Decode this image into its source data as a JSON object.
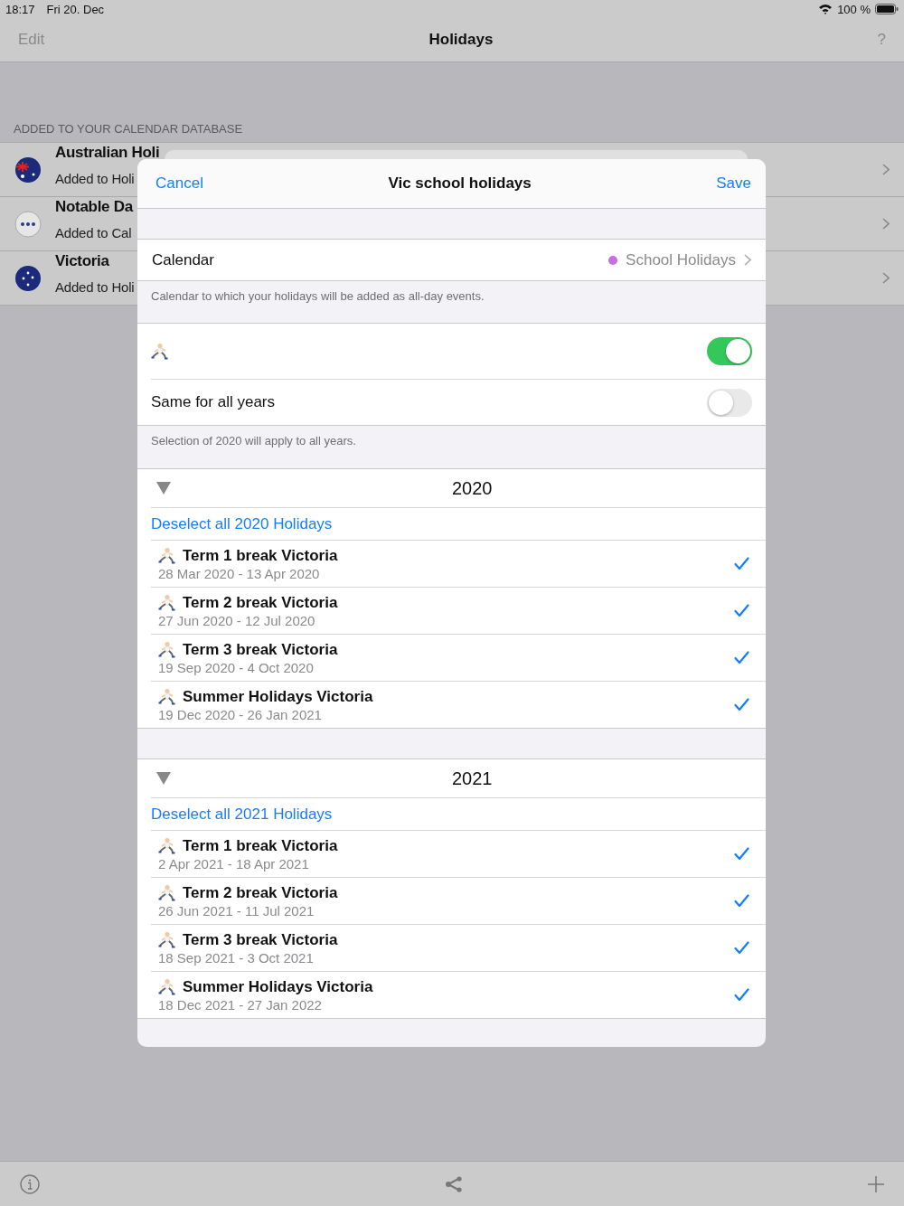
{
  "status_bar": {
    "time": "18:17",
    "date": "Fri 20. Dec",
    "battery": "100 %"
  },
  "nav": {
    "left": "Edit",
    "title": "Holidays",
    "right": "?"
  },
  "section_header": "ADDED TO YOUR CALENDAR DATABASE",
  "calendars": [
    {
      "kind": "flag",
      "name": "Australian Holi",
      "subtitle": "Added to Holi"
    },
    {
      "kind": "dots",
      "name": "Notable Da",
      "subtitle": "Added to Cal"
    },
    {
      "kind": "stars",
      "name": "Victoria",
      "subtitle": "Added to Holi"
    }
  ],
  "modal": {
    "cancel": "Cancel",
    "title": "Vic school holidays",
    "save": "Save",
    "calendar": {
      "label": "Calendar",
      "value": "School Holidays",
      "color": "#c96ee0"
    },
    "calendar_note": "Calendar to which your holidays will be added as all-day events.",
    "toggles": [
      {
        "kind": "icon",
        "on": true
      },
      {
        "kind": "text",
        "label": "Same for all years",
        "on": false
      }
    ],
    "toggle_note": "Selection of 2020 will apply to all years.",
    "years": [
      {
        "year": "2020",
        "expanded": true,
        "deselect": "Deselect all 2020 Holidays",
        "holidays": [
          {
            "name": "Term 1 break Victoria",
            "dates": "28 Mar 2020 - 13 Apr 2020",
            "checked": true
          },
          {
            "name": "Term 2 break Victoria",
            "dates": "27 Jun 2020 - 12 Jul 2020",
            "checked": true
          },
          {
            "name": "Term 3 break Victoria",
            "dates": "19 Sep 2020 - 4 Oct 2020",
            "checked": true
          },
          {
            "name": "Summer Holidays Victoria",
            "dates": "19 Dec 2020 - 26 Jan 2021",
            "checked": true
          }
        ]
      },
      {
        "year": "2021",
        "expanded": true,
        "deselect": "Deselect all 2021 Holidays",
        "holidays": [
          {
            "name": "Term 1 break Victoria",
            "dates": "2 Apr 2021 - 18 Apr 2021",
            "checked": true
          },
          {
            "name": "Term 2 break Victoria",
            "dates": "26 Jun 2021 - 11 Jul 2021",
            "checked": true
          },
          {
            "name": "Term 3 break Victoria",
            "dates": "18 Sep 2021 - 3 Oct 2021",
            "checked": true
          },
          {
            "name": "Summer Holidays Victoria",
            "dates": "18 Dec 2021 - 27 Jan 2022",
            "checked": true
          }
        ]
      }
    ]
  }
}
